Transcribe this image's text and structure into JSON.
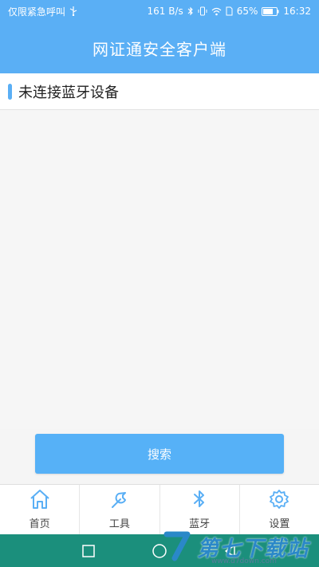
{
  "status_bar": {
    "left_text": "仅限紧急呼叫",
    "network_speed": "161 B/s",
    "battery": "65%",
    "time": "16:32"
  },
  "header": {
    "title": "网证通安全客户端"
  },
  "device_section": {
    "title": "未连接蓝牙设备"
  },
  "search_button": {
    "label": "搜索"
  },
  "bottom_nav": {
    "items": [
      {
        "label": "首页",
        "icon": "home-icon"
      },
      {
        "label": "工具",
        "icon": "wrench-icon"
      },
      {
        "label": "蓝牙",
        "icon": "bluetooth-icon"
      },
      {
        "label": "设置",
        "icon": "gear-icon"
      }
    ]
  },
  "colors": {
    "accent": "#5aaff5",
    "button": "#56b1f7",
    "system_nav": "#1b8f7c"
  },
  "watermark": {
    "text": "第七下载站",
    "url": "www.d7down.com"
  }
}
